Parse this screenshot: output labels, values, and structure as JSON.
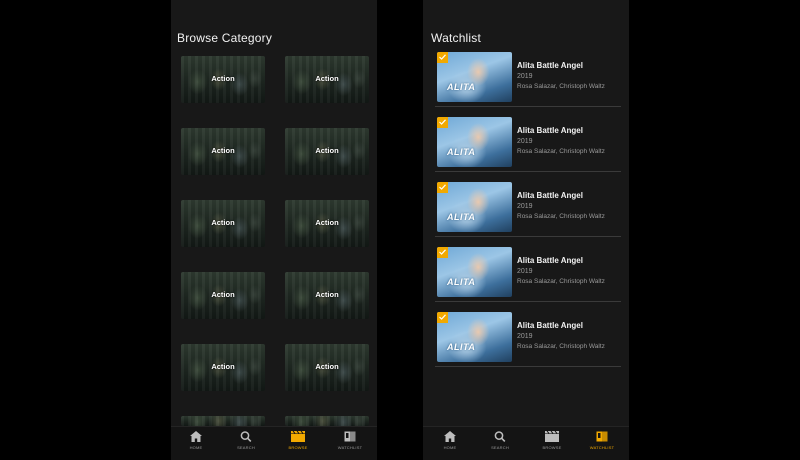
{
  "colors": {
    "accent": "#f2a900",
    "background": "#181818",
    "text": "#f2f2f2",
    "muted": "#9a9a9a"
  },
  "browse": {
    "title": "Browse Category",
    "categories": [
      "Action",
      "Action",
      "Action",
      "Action",
      "Action",
      "Action",
      "Action",
      "Action",
      "Action",
      "Action"
    ]
  },
  "watchlist": {
    "title": "Watchlist",
    "items": [
      {
        "poster_title": "ALITA",
        "title": "Alita Battle Angel",
        "year": "2019",
        "cast": "Rosa Salazar, Christoph Waltz"
      },
      {
        "poster_title": "ALITA",
        "title": "Alita Battle Angel",
        "year": "2019",
        "cast": "Rosa Salazar, Christoph Waltz"
      },
      {
        "poster_title": "ALITA",
        "title": "Alita Battle Angel",
        "year": "2019",
        "cast": "Rosa Salazar, Christoph Waltz"
      },
      {
        "poster_title": "ALITA",
        "title": "Alita Battle Angel",
        "year": "2019",
        "cast": "Rosa Salazar, Christoph Waltz"
      },
      {
        "poster_title": "ALITA",
        "title": "Alita Battle Angel",
        "year": "2019",
        "cast": "Rosa Salazar, Christoph Waltz"
      }
    ]
  },
  "tabs_browse": [
    {
      "label": "HOME",
      "icon": "home-icon",
      "active": false
    },
    {
      "label": "SEARCH",
      "icon": "search-icon",
      "active": false
    },
    {
      "label": "BROWSE",
      "icon": "clapperboard-icon",
      "active": true
    },
    {
      "label": "WATCHLIST",
      "icon": "watchlist-icon",
      "active": false
    }
  ],
  "tabs_watch": [
    {
      "label": "HOME",
      "icon": "home-icon",
      "active": false
    },
    {
      "label": "SEARCH",
      "icon": "search-icon",
      "active": false
    },
    {
      "label": "BROWSE",
      "icon": "clapperboard-icon",
      "active": false
    },
    {
      "label": "WATCHLIST",
      "icon": "watchlist-icon",
      "active": true
    }
  ]
}
